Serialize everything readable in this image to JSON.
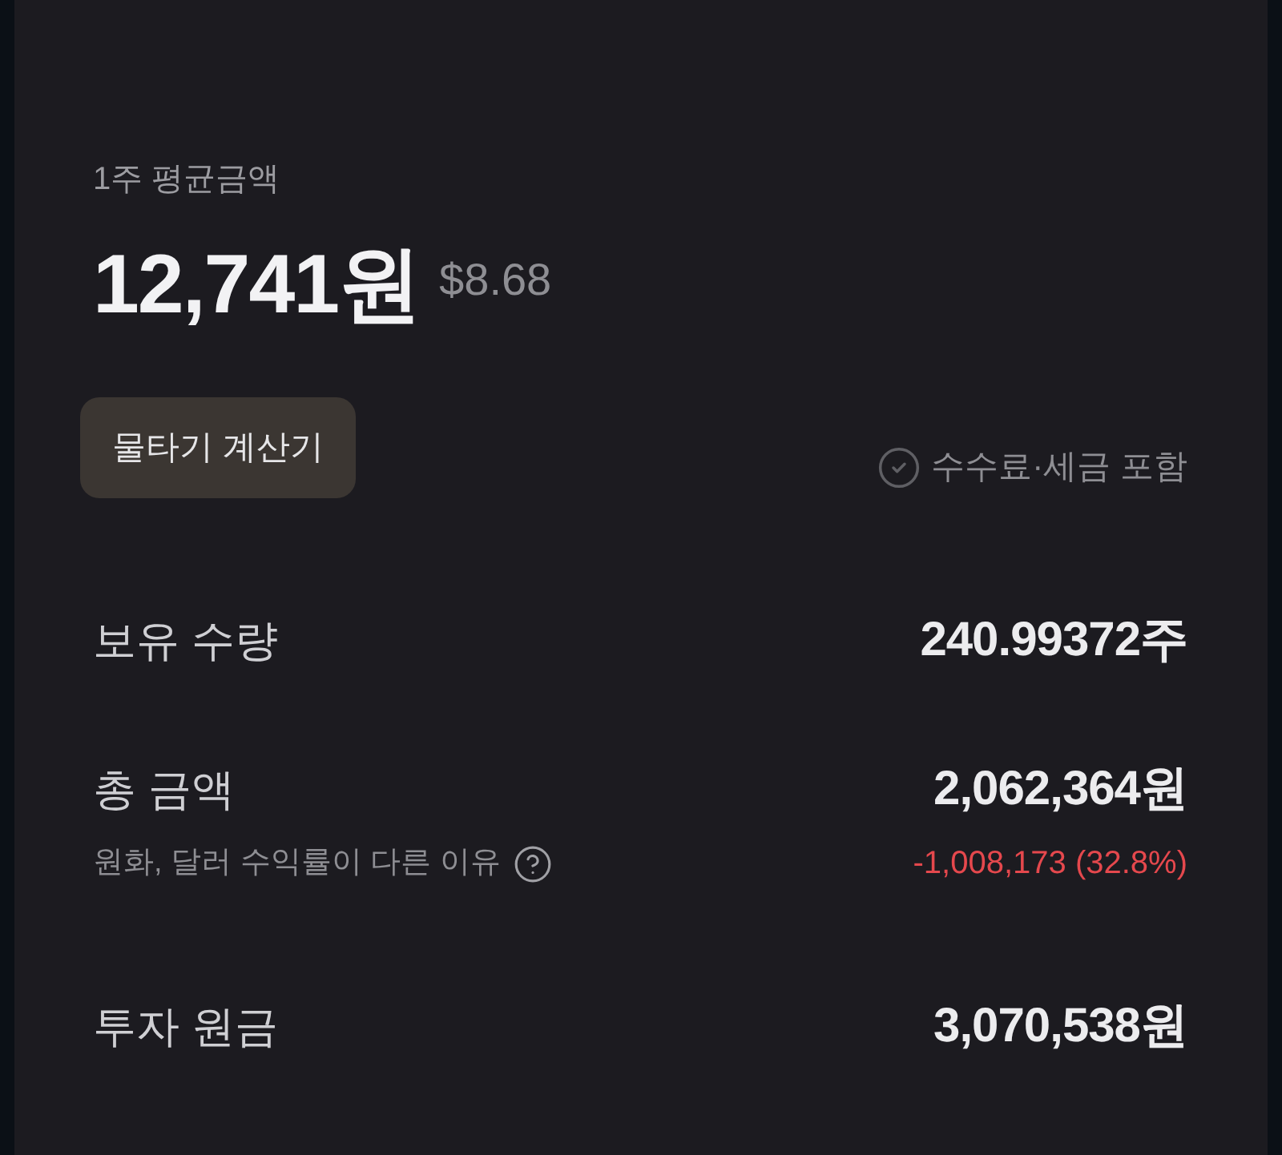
{
  "summary": {
    "label": "1주 평균금액",
    "price": "12,741원",
    "price_usd": "$8.68"
  },
  "calculator_button": {
    "label": "물타기 계산기"
  },
  "fee_option": {
    "label": "수수료·세금 포함",
    "checked": false
  },
  "rows": [
    {
      "label": "보유 수량",
      "value": "240.99372주"
    },
    {
      "label": "총 금액",
      "value": "2,062,364원",
      "note": "원화, 달러 수익률이 다른 이유",
      "change": {
        "text": "-1,008,173 (32.8%)",
        "kind": "loss"
      }
    },
    {
      "label": "투자 원금",
      "value": "3,070,538원"
    }
  ]
}
